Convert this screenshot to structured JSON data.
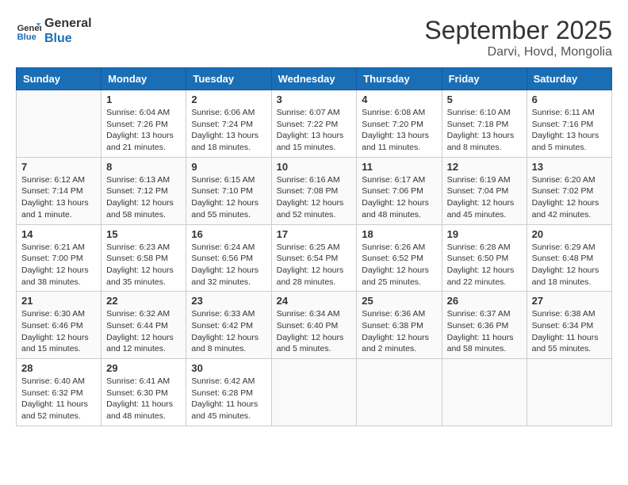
{
  "header": {
    "logo_line1": "General",
    "logo_line2": "Blue",
    "month": "September 2025",
    "location": "Darvi, Hovd, Mongolia"
  },
  "weekdays": [
    "Sunday",
    "Monday",
    "Tuesday",
    "Wednesday",
    "Thursday",
    "Friday",
    "Saturday"
  ],
  "weeks": [
    [
      {
        "day": "",
        "info": ""
      },
      {
        "day": "1",
        "info": "Sunrise: 6:04 AM\nSunset: 7:26 PM\nDaylight: 13 hours\nand 21 minutes."
      },
      {
        "day": "2",
        "info": "Sunrise: 6:06 AM\nSunset: 7:24 PM\nDaylight: 13 hours\nand 18 minutes."
      },
      {
        "day": "3",
        "info": "Sunrise: 6:07 AM\nSunset: 7:22 PM\nDaylight: 13 hours\nand 15 minutes."
      },
      {
        "day": "4",
        "info": "Sunrise: 6:08 AM\nSunset: 7:20 PM\nDaylight: 13 hours\nand 11 minutes."
      },
      {
        "day": "5",
        "info": "Sunrise: 6:10 AM\nSunset: 7:18 PM\nDaylight: 13 hours\nand 8 minutes."
      },
      {
        "day": "6",
        "info": "Sunrise: 6:11 AM\nSunset: 7:16 PM\nDaylight: 13 hours\nand 5 minutes."
      }
    ],
    [
      {
        "day": "7",
        "info": "Sunrise: 6:12 AM\nSunset: 7:14 PM\nDaylight: 13 hours\nand 1 minute."
      },
      {
        "day": "8",
        "info": "Sunrise: 6:13 AM\nSunset: 7:12 PM\nDaylight: 12 hours\nand 58 minutes."
      },
      {
        "day": "9",
        "info": "Sunrise: 6:15 AM\nSunset: 7:10 PM\nDaylight: 12 hours\nand 55 minutes."
      },
      {
        "day": "10",
        "info": "Sunrise: 6:16 AM\nSunset: 7:08 PM\nDaylight: 12 hours\nand 52 minutes."
      },
      {
        "day": "11",
        "info": "Sunrise: 6:17 AM\nSunset: 7:06 PM\nDaylight: 12 hours\nand 48 minutes."
      },
      {
        "day": "12",
        "info": "Sunrise: 6:19 AM\nSunset: 7:04 PM\nDaylight: 12 hours\nand 45 minutes."
      },
      {
        "day": "13",
        "info": "Sunrise: 6:20 AM\nSunset: 7:02 PM\nDaylight: 12 hours\nand 42 minutes."
      }
    ],
    [
      {
        "day": "14",
        "info": "Sunrise: 6:21 AM\nSunset: 7:00 PM\nDaylight: 12 hours\nand 38 minutes."
      },
      {
        "day": "15",
        "info": "Sunrise: 6:23 AM\nSunset: 6:58 PM\nDaylight: 12 hours\nand 35 minutes."
      },
      {
        "day": "16",
        "info": "Sunrise: 6:24 AM\nSunset: 6:56 PM\nDaylight: 12 hours\nand 32 minutes."
      },
      {
        "day": "17",
        "info": "Sunrise: 6:25 AM\nSunset: 6:54 PM\nDaylight: 12 hours\nand 28 minutes."
      },
      {
        "day": "18",
        "info": "Sunrise: 6:26 AM\nSunset: 6:52 PM\nDaylight: 12 hours\nand 25 minutes."
      },
      {
        "day": "19",
        "info": "Sunrise: 6:28 AM\nSunset: 6:50 PM\nDaylight: 12 hours\nand 22 minutes."
      },
      {
        "day": "20",
        "info": "Sunrise: 6:29 AM\nSunset: 6:48 PM\nDaylight: 12 hours\nand 18 minutes."
      }
    ],
    [
      {
        "day": "21",
        "info": "Sunrise: 6:30 AM\nSunset: 6:46 PM\nDaylight: 12 hours\nand 15 minutes."
      },
      {
        "day": "22",
        "info": "Sunrise: 6:32 AM\nSunset: 6:44 PM\nDaylight: 12 hours\nand 12 minutes."
      },
      {
        "day": "23",
        "info": "Sunrise: 6:33 AM\nSunset: 6:42 PM\nDaylight: 12 hours\nand 8 minutes."
      },
      {
        "day": "24",
        "info": "Sunrise: 6:34 AM\nSunset: 6:40 PM\nDaylight: 12 hours\nand 5 minutes."
      },
      {
        "day": "25",
        "info": "Sunrise: 6:36 AM\nSunset: 6:38 PM\nDaylight: 12 hours\nand 2 minutes."
      },
      {
        "day": "26",
        "info": "Sunrise: 6:37 AM\nSunset: 6:36 PM\nDaylight: 11 hours\nand 58 minutes."
      },
      {
        "day": "27",
        "info": "Sunrise: 6:38 AM\nSunset: 6:34 PM\nDaylight: 11 hours\nand 55 minutes."
      }
    ],
    [
      {
        "day": "28",
        "info": "Sunrise: 6:40 AM\nSunset: 6:32 PM\nDaylight: 11 hours\nand 52 minutes."
      },
      {
        "day": "29",
        "info": "Sunrise: 6:41 AM\nSunset: 6:30 PM\nDaylight: 11 hours\nand 48 minutes."
      },
      {
        "day": "30",
        "info": "Sunrise: 6:42 AM\nSunset: 6:28 PM\nDaylight: 11 hours\nand 45 minutes."
      },
      {
        "day": "",
        "info": ""
      },
      {
        "day": "",
        "info": ""
      },
      {
        "day": "",
        "info": ""
      },
      {
        "day": "",
        "info": ""
      }
    ]
  ]
}
